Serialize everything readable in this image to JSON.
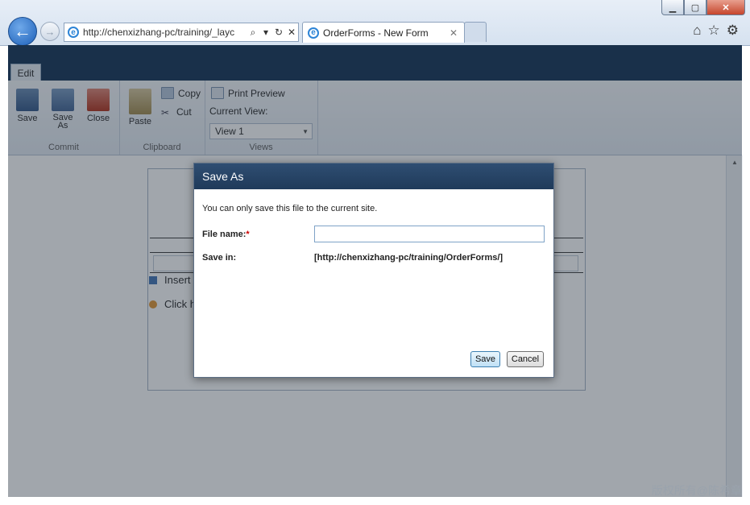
{
  "browser": {
    "address_url": "http://chenxizhang-pc/training/_layc",
    "tab_title": "OrderForms - New Form",
    "window_controls": {
      "minimize_icon": "minimize-icon",
      "maximize_icon": "maximize-icon",
      "close_icon": "close-icon"
    }
  },
  "ribbon": {
    "tab_label": "Edit",
    "commit": {
      "label": "Commit",
      "save": "Save",
      "save_as": "Save As",
      "close": "Close"
    },
    "clipboard": {
      "label": "Clipboard",
      "paste": "Paste",
      "copy": "Copy",
      "cut": "Cut"
    },
    "views": {
      "label": "Views",
      "print_preview": "Print Preview",
      "current_view_label": "Current View:",
      "current_view_value": "View 1"
    }
  },
  "form": {
    "insert_label": "Insert",
    "click_label": "Click h"
  },
  "dialog": {
    "title": "Save As",
    "message": "You can only save this file to the current site.",
    "file_name_label": "File name:",
    "required_marker": "*",
    "file_name_value": "",
    "save_in_label": "Save in:",
    "save_in_value": "[http://chenxizhang-pc/training/OrderForms/]",
    "save_button": "Save",
    "cancel_button": "Cancel"
  },
  "watermark": "版权所有@陈希章",
  "colors": {
    "header_navy": "#1d3b5c",
    "dialog_header": "#2f4e72",
    "ie_blue": "#2d84d6",
    "required_red": "#cc0000"
  }
}
